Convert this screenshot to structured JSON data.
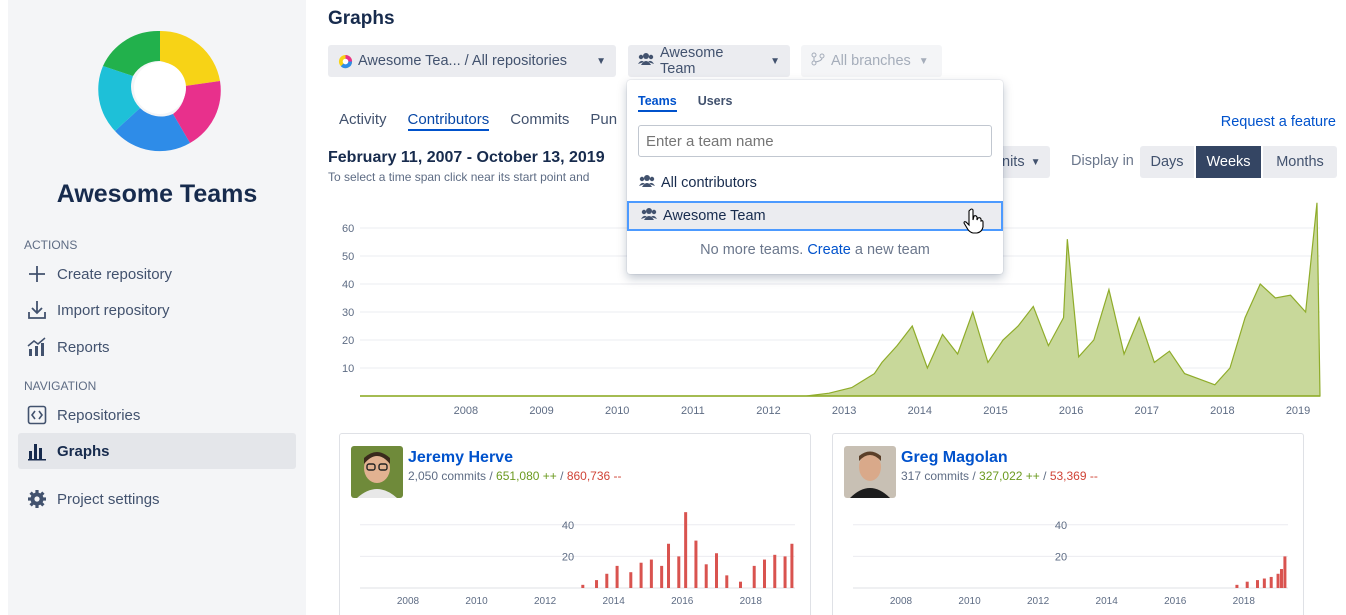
{
  "sidebar": {
    "project_name": "Awesome Teams",
    "actions_heading": "ACTIONS",
    "navigation_heading": "NAVIGATION",
    "actions": [
      {
        "label": "Create repository",
        "icon": "plus-icon"
      },
      {
        "label": "Import repository",
        "icon": "import-icon"
      },
      {
        "label": "Reports",
        "icon": "reports-icon"
      }
    ],
    "navigation": [
      {
        "label": "Repositories",
        "icon": "code-icon"
      },
      {
        "label": "Graphs",
        "icon": "bar-graph-icon"
      },
      {
        "label": "Project settings",
        "icon": "gear-icon"
      }
    ]
  },
  "header": {
    "title": "Graphs",
    "repo_selector": "Awesome Tea... / All repositories",
    "team_selector": "Awesome Team",
    "branch_selector": "All branches"
  },
  "tabs": [
    "Activity",
    "Contributors",
    "Commits",
    "Pun"
  ],
  "active_tab": "Contributors",
  "request_feature": "Request a feature",
  "date_range": "February 11, 2007 - October 13, 2019",
  "hint": "To select a time span click near its start point and",
  "metric_button": "nits",
  "display_in_label": "Display in",
  "display_options": [
    "Days",
    "Weeks",
    "Months"
  ],
  "display_selected": "Weeks",
  "dropdown": {
    "tabs": [
      "Teams",
      "Users"
    ],
    "active_tab": "Teams",
    "search_placeholder": "Enter a team name",
    "items": [
      "All contributors",
      "Awesome Team"
    ],
    "highlighted": "Awesome Team",
    "footer_prefix": "No more teams.",
    "footer_link": "Create",
    "footer_suffix": "a new team"
  },
  "chart_data": [
    {
      "type": "area",
      "title": "",
      "xlabel": "",
      "ylabel": "",
      "x_ticks": [
        "2008",
        "2009",
        "2010",
        "2011",
        "2012",
        "2013",
        "2014",
        "2015",
        "2016",
        "2017",
        "2018",
        "2019"
      ],
      "y_ticks": [
        10,
        20,
        30,
        40,
        50,
        60
      ],
      "ylim": [
        0,
        70
      ],
      "color": "#8fac2a",
      "series": [
        {
          "x": [
            "2013.0",
            "2013.3",
            "2013.6",
            "2013.9",
            "2014.0",
            "2014.2",
            "2014.4",
            "2014.6",
            "2014.8",
            "2015.0",
            "2015.2",
            "2015.4",
            "2015.6",
            "2015.8",
            "2016.0",
            "2016.2",
            "2016.4",
            "2016.45",
            "2016.6",
            "2016.8",
            "2017.0",
            "2017.2",
            "2017.4",
            "2017.6",
            "2017.8",
            "2018.0",
            "2018.2",
            "2018.4",
            "2018.6",
            "2018.8",
            "2019.0",
            "2019.2",
            "2019.4",
            "2019.6",
            "2019.75"
          ],
          "y": [
            0,
            1,
            3,
            8,
            12,
            18,
            25,
            10,
            22,
            15,
            30,
            12,
            20,
            25,
            32,
            18,
            28,
            56,
            14,
            20,
            38,
            15,
            28,
            12,
            16,
            8,
            6,
            4,
            10,
            28,
            40,
            35,
            36,
            30,
            69
          ]
        }
      ]
    },
    {
      "type": "bar",
      "title": "",
      "x_ticks": [
        "2008",
        "2010",
        "2012",
        "2014",
        "2016",
        "2018"
      ],
      "y_ticks": [
        20,
        40
      ],
      "ylim": [
        0,
        50
      ],
      "color": "#d9534f",
      "series": [
        {
          "x": [
            2013.6,
            2014.0,
            2014.3,
            2014.6,
            2015.0,
            2015.3,
            2015.6,
            2015.9,
            2016.1,
            2016.4,
            2016.6,
            2016.9,
            2017.2,
            2017.5,
            2017.8,
            2018.2,
            2018.6,
            2018.9,
            2019.2,
            2019.5,
            2019.7
          ],
          "values": [
            2,
            5,
            9,
            14,
            10,
            16,
            18,
            14,
            28,
            20,
            48,
            30,
            15,
            22,
            8,
            4,
            14,
            18,
            21,
            20,
            28
          ]
        }
      ]
    },
    {
      "type": "bar",
      "title": "",
      "x_ticks": [
        "2008",
        "2010",
        "2012",
        "2014",
        "2016",
        "2018"
      ],
      "y_ticks": [
        20,
        40
      ],
      "ylim": [
        0,
        50
      ],
      "color": "#d9534f",
      "series": [
        {
          "x": [
            2018.3,
            2018.6,
            2018.9,
            2019.1,
            2019.3,
            2019.5,
            2019.6,
            2019.7
          ],
          "values": [
            2,
            4,
            5,
            6,
            7,
            9,
            12,
            20
          ]
        }
      ]
    }
  ],
  "contributors": [
    {
      "name": "Jeremy Herve",
      "commits": "2,050 commits /",
      "added": "651,080 ++",
      "sep": "/",
      "removed": "860,736 --"
    },
    {
      "name": "Greg Magolan",
      "commits": "317 commits /",
      "added": "327,022 ++",
      "sep": "/",
      "removed": "53,369 --"
    }
  ]
}
